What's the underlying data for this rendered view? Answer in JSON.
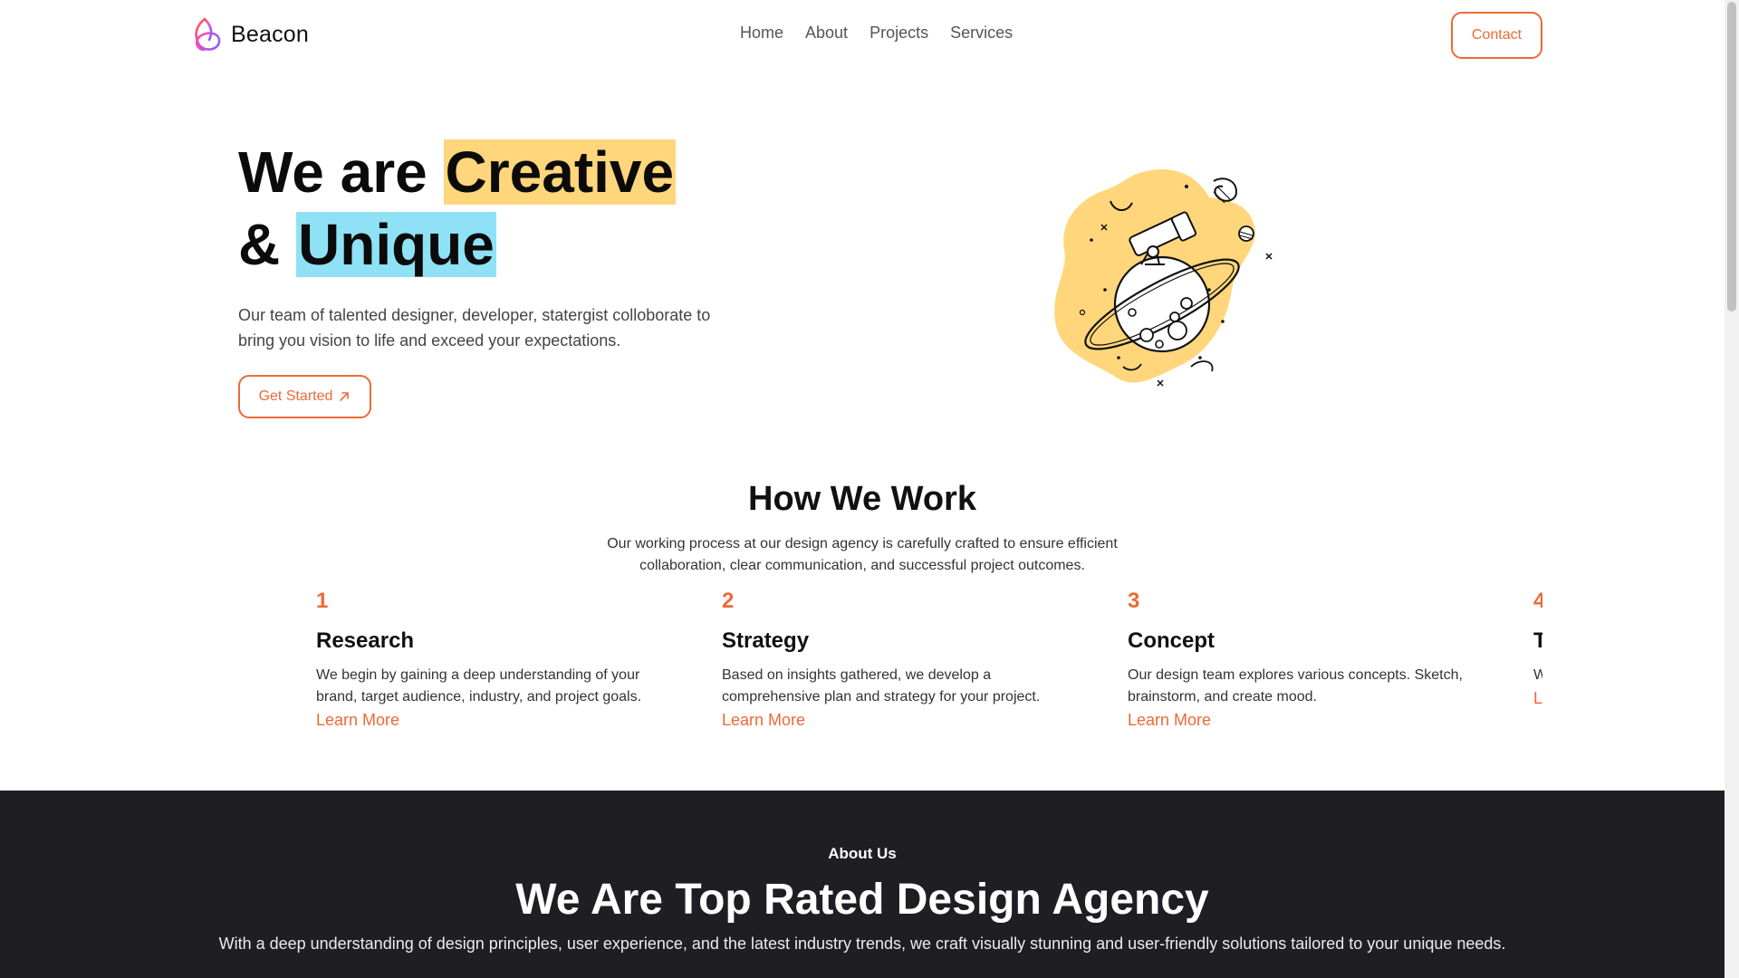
{
  "brand": {
    "name": "Beacon",
    "accent": "#ec6a37",
    "logo_icon": "beacon-loop-icon"
  },
  "nav": {
    "items": [
      "Home",
      "About",
      "Projects",
      "Services"
    ],
    "contact_label": "Contact"
  },
  "hero": {
    "title_part1": "We are ",
    "title_highlight1": "Creative",
    "title_part2": "& ",
    "title_highlight2": "Unique",
    "description": "Our team of talented designer, developer, statergist colloborate to bring you vision to life and exceed your expectations.",
    "cta_label": "Get Started",
    "cta_icon": "arrow-up-right-icon",
    "highlight_colors": [
      "#ffd67b",
      "#8fe2f6"
    ],
    "illustration_icon": "planet-telescope-illustration"
  },
  "how_we_work": {
    "title": "How We Work",
    "description": "Our working process at our design agency is carefully crafted to ensure efficient collaboration, clear communication, and successful project outcomes.",
    "steps": [
      {
        "number": "1",
        "title": "Research",
        "text": "We begin by gaining a deep understanding of your brand, target audience, industry, and project goals.",
        "link": "Learn More"
      },
      {
        "number": "2",
        "title": "Strategy",
        "text": "Based on insights gathered, we develop a comprehensive plan and strategy for your project.",
        "link": "Learn More"
      },
      {
        "number": "3",
        "title": "Concept",
        "text": "Our design team explores various concepts. Sketch, brainstorm, and create mood.",
        "link": "Learn More"
      },
      {
        "number": "4",
        "title": "T",
        "text": "W d",
        "link": "L"
      }
    ]
  },
  "about": {
    "label": "About Us",
    "title": "We Are Top Rated Design Agency",
    "description": "With a deep understanding of design principles, user experience, and the latest industry trends, we craft visually stunning and user-friendly solutions tailored to your unique needs."
  }
}
